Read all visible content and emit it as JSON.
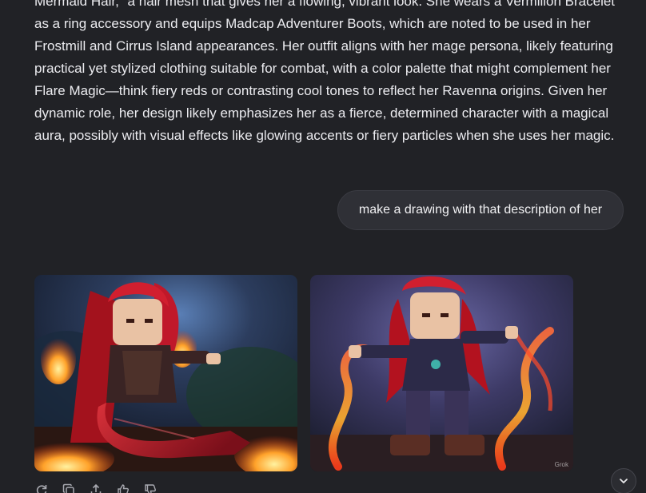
{
  "assistant_message": {
    "lines": [
      "Mermaid Hair,\" a hair mesh that gives her a flowing, vibrant look. She wears a Vermilion Bracelet",
      "as a ring accessory and equips Madcap Adventurer Boots, which are noted to be used in her",
      "Frostmill and Cirrus Island appearances. Her outfit aligns with her mage persona, likely featuring",
      "practical yet stylized clothing suitable for combat, with a color palette that might complement her",
      "Flare Magic—think fiery reds or contrasting cool tones to reflect her Ravenna origins. Given her",
      "dynamic role, her design likely emphasizes her as a fierce, determined character with a magical",
      "aura, possibly with visual effects like glowing accents or fiery particles when she uses her magic."
    ]
  },
  "user_message": {
    "text": "make a drawing with that description of her"
  },
  "generated_images": {
    "watermark": "Grok"
  },
  "actions": [
    {
      "name": "regenerate-icon"
    },
    {
      "name": "copy-icon"
    },
    {
      "name": "share-icon"
    },
    {
      "name": "thumbs-up-icon"
    },
    {
      "name": "thumbs-down-icon"
    }
  ],
  "colors": {
    "background": "#212226",
    "bubble": "#2f3036",
    "text": "#ececf0",
    "icon": "#a8a9b0"
  }
}
